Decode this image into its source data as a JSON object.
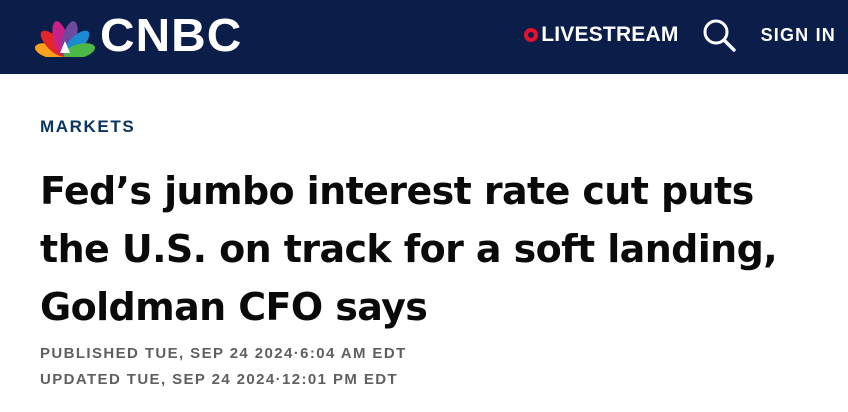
{
  "header": {
    "brand": "CNBC",
    "livestream_label": "LIVESTREAM",
    "signin_label": "SIGN IN",
    "icons": {
      "logo": "nbc-peacock-icon",
      "live": "live-dot-icon",
      "search": "search-icon"
    }
  },
  "article": {
    "section": "MARKETS",
    "headline": "Fed’s jumbo interest rate cut puts the U.S. on track for a soft landing, Goldman CFO says",
    "published": "PUBLISHED TUE, SEP 24 2024·6:04 AM EDT",
    "updated": "UPDATED TUE, SEP 24 2024·12:01 PM EDT"
  },
  "colors": {
    "header_bg": "#0b1d49",
    "live_red": "#e4122c",
    "section_blue": "#0b3560",
    "headline": "#0a0a0a",
    "meta_gray": "#5f5f5f"
  }
}
